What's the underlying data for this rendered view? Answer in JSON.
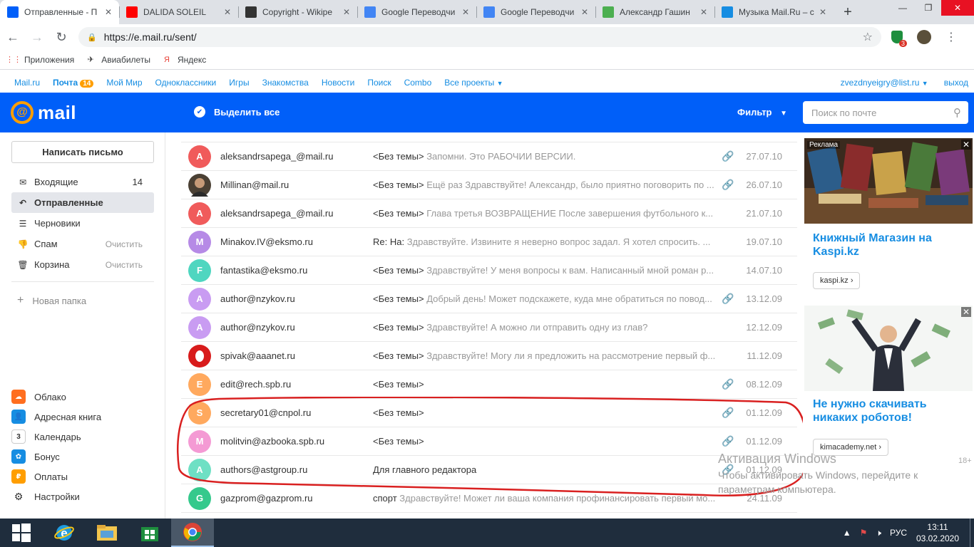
{
  "browser": {
    "tabs": [
      {
        "title": "Отправленные - П",
        "icon": "mail-envelope-icon",
        "color": "#005ff9",
        "active": true
      },
      {
        "title": "DALIDA SOLEIL",
        "icon": "youtube-icon",
        "color": "#ff0000",
        "active": false
      },
      {
        "title": "Copyright - Wikipe",
        "icon": "wikipedia-icon",
        "color": "#333333",
        "active": false
      },
      {
        "title": "Google Переводчи",
        "icon": "google-translate-icon",
        "color": "#4285f4",
        "active": false
      },
      {
        "title": "Google Переводчи",
        "icon": "google-translate-icon",
        "color": "#4285f4",
        "active": false
      },
      {
        "title": "Александр Гашин",
        "icon": "green-page-icon",
        "color": "#4caf50",
        "active": false
      },
      {
        "title": "Музыка Mail.Ru – с",
        "icon": "mailru-music-icon",
        "color": "#168de2",
        "active": false
      }
    ],
    "new_tab": "+",
    "url": "https://e.mail.ru/sent/",
    "extension_badge": "3",
    "bookmarks": [
      {
        "label": "Приложения",
        "icon": "apps-grid-icon"
      },
      {
        "label": "Авиабилеты",
        "icon": "airplane-icon"
      },
      {
        "label": "Яндекс",
        "icon": "yandex-icon"
      }
    ]
  },
  "portal": {
    "links": [
      "Mail.ru",
      "Почта",
      "Мой Мир",
      "Одноклассники",
      "Игры",
      "Знакомства",
      "Новости",
      "Поиск",
      "Combo",
      "Все проекты"
    ],
    "mail_badge": "14",
    "account": "zvezdnyeigry@list.ru",
    "logout": "выход"
  },
  "header": {
    "logo": "mail",
    "select_all": "Выделить все",
    "filter": "Фильтр",
    "search_placeholder": "Поиск по почте"
  },
  "sidebar": {
    "compose": "Написать письмо",
    "folders": [
      {
        "name": "Входящие",
        "count": "14",
        "clean": "",
        "icon": "inbox-icon",
        "active": false
      },
      {
        "name": "Отправленные",
        "count": "",
        "clean": "",
        "icon": "sent-arrow-icon",
        "active": true
      },
      {
        "name": "Черновики",
        "count": "",
        "clean": "",
        "icon": "drafts-icon",
        "active": false
      },
      {
        "name": "Спам",
        "count": "",
        "clean": "Очистить",
        "icon": "spam-thumb-icon",
        "active": false
      },
      {
        "name": "Корзина",
        "count": "",
        "clean": "Очистить",
        "icon": "trash-icon",
        "active": false
      }
    ],
    "new_folder": "Новая папка",
    "services": [
      {
        "name": "Облако",
        "icon": "cloud-icon",
        "color": "#ff6e1f"
      },
      {
        "name": "Адресная книга",
        "icon": "address-book-icon",
        "color": "#168de2"
      },
      {
        "name": "Календарь",
        "icon": "calendar-icon",
        "color": "#ffffff"
      },
      {
        "name": "Бонус",
        "icon": "bonus-icon",
        "color": "#168de2"
      },
      {
        "name": "Оплаты",
        "icon": "payments-icon",
        "color": "#ff9e00"
      },
      {
        "name": "Настройки",
        "icon": "settings-gear-icon",
        "color": "#ffffff"
      }
    ]
  },
  "messages": [
    {
      "avatar": "A",
      "color": "#f05b5b",
      "sender": "aleksandrsapega_@mail.ru",
      "subject": "<Без темы>",
      "snippet": "Запомни. Это РАБОЧИИ ВЕРСИИ.",
      "attach": true,
      "date": "27.07.10"
    },
    {
      "avatar": "",
      "color": "#4a4034",
      "sender": "Millinan@mail.ru",
      "subject": "<Без темы>",
      "snippet": "Ещё раз Здравствуйте! Александр, было приятно поговорить по ...",
      "attach": true,
      "date": "26.07.10"
    },
    {
      "avatar": "A",
      "color": "#f05b5b",
      "sender": "aleksandrsapega_@mail.ru",
      "subject": "<Без темы>",
      "snippet": "Глава третья ВОЗВРАЩЕНИЕ После завершения футбольного к...",
      "attach": false,
      "date": "21.07.10"
    },
    {
      "avatar": "M",
      "color": "#b68ae6",
      "sender": "Minakov.IV@eksmo.ru",
      "subject": "Re: На:",
      "snippet": "Здравствуйте. Извините я неверно вопрос задал. Я хотел спросить. ...",
      "attach": false,
      "date": "19.07.10"
    },
    {
      "avatar": "F",
      "color": "#4fd6c0",
      "sender": "fantastika@eksmo.ru",
      "subject": "<Без темы>",
      "snippet": "Здравствуйте! У меня вопросы к вам. Написанный мной роман р...",
      "attach": false,
      "date": "14.07.10"
    },
    {
      "avatar": "A",
      "color": "#c99cf2",
      "sender": "author@nzykov.ru",
      "subject": "<Без темы>",
      "snippet": "Добрый день! Может подскажете, куда мне обратиться по повод...",
      "attach": true,
      "date": "13.12.09"
    },
    {
      "avatar": "A",
      "color": "#c99cf2",
      "sender": "author@nzykov.ru",
      "subject": "<Без темы>",
      "snippet": "Здравствуйте! А можно ли отправить одну из глав?",
      "attach": false,
      "date": "12.12.09"
    },
    {
      "avatar": "",
      "color": "#d81b1b",
      "sender": "spivak@aaanet.ru",
      "subject": "<Без темы>",
      "snippet": "Здравствуйте! Могу ли я предложить на рассмотрение первый ф...",
      "attach": false,
      "date": "11.12.09"
    },
    {
      "avatar": "E",
      "color": "#ffa95e",
      "sender": "edit@rech.spb.ru",
      "subject": "<Без темы>",
      "snippet": "",
      "attach": true,
      "date": "08.12.09"
    },
    {
      "avatar": "S",
      "color": "#ffa95e",
      "sender": "secretary01@cnpol.ru",
      "subject": "<Без темы>",
      "snippet": "",
      "attach": true,
      "date": "01.12.09"
    },
    {
      "avatar": "M",
      "color": "#f49ad4",
      "sender": "molitvin@azbooka.spb.ru",
      "subject": "<Без темы>",
      "snippet": "",
      "attach": true,
      "date": "01.12.09"
    },
    {
      "avatar": "A",
      "color": "#6ee0c4",
      "sender": "authors@astgroup.ru",
      "subject": "Для главного редактора",
      "snippet": "",
      "attach": true,
      "date": "01.12.09"
    },
    {
      "avatar": "G",
      "color": "#35c98c",
      "sender": "gazprom@gazprom.ru",
      "subject": "спорт",
      "snippet": "Здравствуйте! Может ли ваша компания профинансировать первый мо...",
      "attach": false,
      "date": "24.11.09"
    }
  ],
  "ads": [
    {
      "label": "Реклама",
      "title": "Книжный Магазин на Kaspi.kz",
      "link": "kaspi.kz"
    },
    {
      "label": "",
      "title": "Не нужно скачивать никаких роботов!",
      "link": "kimacademy.net"
    }
  ],
  "age_rating": "18+",
  "watermark": {
    "line1": "Активация Windows",
    "line2": "Чтобы активировать Windows, перейдите к параметрам компьютера."
  },
  "taskbar": {
    "apps": [
      "windows-start-icon",
      "internet-explorer-icon",
      "file-explorer-icon",
      "store-icon",
      "chrome-icon"
    ],
    "language": "РУС",
    "time": "13:11",
    "date": "03.02.2020"
  }
}
